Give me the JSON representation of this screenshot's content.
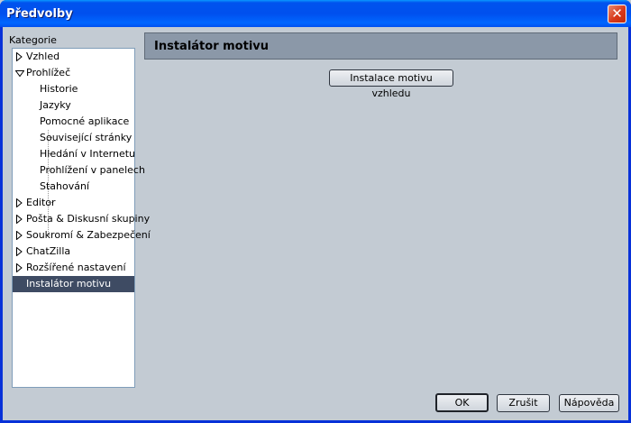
{
  "window": {
    "title": "Předvolby",
    "close_glyph": "✕"
  },
  "sidebar": {
    "label": "Kategorie",
    "items": [
      {
        "label": "Vzhled",
        "level": 0,
        "twisty": "collapsed"
      },
      {
        "label": "Prohlížeč",
        "level": 0,
        "twisty": "expanded"
      },
      {
        "label": "Historie",
        "level": 1
      },
      {
        "label": "Jazyky",
        "level": 1
      },
      {
        "label": "Pomocné aplikace",
        "level": 1
      },
      {
        "label": "Související stránky",
        "level": 1
      },
      {
        "label": "Hledání v Internetu",
        "level": 1
      },
      {
        "label": "Prohlížení v panelech",
        "level": 1
      },
      {
        "label": "Stahování",
        "level": 1
      },
      {
        "label": "Editor",
        "level": 0,
        "twisty": "collapsed"
      },
      {
        "label": "Pošta & Diskusní skupiny",
        "level": 0,
        "twisty": "collapsed"
      },
      {
        "label": "Soukromí & Zabezpečení",
        "level": 0,
        "twisty": "collapsed"
      },
      {
        "label": "ChatZilla",
        "level": 0,
        "twisty": "collapsed"
      },
      {
        "label": "Rozšířené nastavení",
        "level": 0,
        "twisty": "collapsed"
      },
      {
        "label": "Instalátor motivu",
        "level": 0,
        "selected": true
      }
    ]
  },
  "panel": {
    "title": "Instalátor motivu",
    "install_button": "Instalace motivu vzhledu"
  },
  "footer": {
    "ok": "OK",
    "cancel": "Zrušit",
    "help": "Nápověda"
  }
}
